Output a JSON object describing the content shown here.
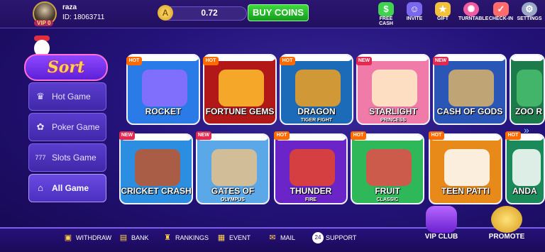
{
  "header": {
    "username": "raza",
    "user_id": "ID: 18063711",
    "vip": "VIP 0",
    "balance": "0.72",
    "buy_coins": "BUY COINS",
    "shortcuts": [
      {
        "label": "FREE CASH",
        "icon": "cash-icon",
        "color": "#3fd34e"
      },
      {
        "label": "INVITE",
        "icon": "invite-icon",
        "color": "#7a67f0"
      },
      {
        "label": "GIFT",
        "icon": "gift-icon",
        "color": "#f2c23a"
      },
      {
        "label": "TURNTABLE",
        "icon": "turntable-icon",
        "color": "#f25aa2"
      },
      {
        "label": "CHECK-IN",
        "icon": "checkin-icon",
        "color": "#ff6a6a"
      },
      {
        "label": "SETTINGS",
        "icon": "gear-icon",
        "color": "#9aa7c7"
      }
    ]
  },
  "sidebar": {
    "logo": "Sort",
    "items": [
      {
        "label": "Hot Game",
        "icon": "crown-icon"
      },
      {
        "label": "Poker Game",
        "icon": "poker-chip-icon"
      },
      {
        "label": "Slots Game",
        "icon": "slots-icon"
      },
      {
        "label": "All Game",
        "icon": "home-icon"
      }
    ]
  },
  "games": {
    "row1": [
      {
        "title": "ROCKET",
        "sub": "",
        "tag": "HOT",
        "color": "#2a7be8",
        "art": "#8f6dff"
      },
      {
        "title": "FORTUNE GEMS",
        "sub": "",
        "tag": "HOT",
        "color": "#b31818",
        "art": "#ffc12b"
      },
      {
        "title": "DRAGON",
        "sub": "TIGER FIGHT",
        "tag": "HOT",
        "color": "#1b6bb8",
        "art": "#f0a020"
      },
      {
        "title": "STARLIGHT",
        "sub": "PRINCESS",
        "tag": "NEW",
        "color": "#f07aa8",
        "art": "#fff0c8"
      },
      {
        "title": "CASH OF GODS",
        "sub": "",
        "tag": "NEW",
        "color": "#2a56b8",
        "art": "#d9b26a"
      },
      {
        "title": "ZOO R",
        "sub": "",
        "tag": "",
        "color": "#1d7a4a",
        "art": "#4ac070"
      }
    ],
    "row2": [
      {
        "title": "CRICKET CRASH",
        "sub": "",
        "tag": "NEW",
        "color": "#2b8ee0",
        "art": "#c0552a"
      },
      {
        "title": "GATES OF",
        "sub": "OLYMPUS",
        "tag": "NEW",
        "color": "#5aa8e8",
        "art": "#e6c28a"
      },
      {
        "title": "THUNDER",
        "sub": "FIRE",
        "tag": "HOT",
        "color": "#6b24c8",
        "art": "#e8442a"
      },
      {
        "title": "FRUIT",
        "sub": "CLASSIC",
        "tag": "HOT",
        "color": "#2fb85a",
        "art": "#e84a4a"
      },
      {
        "title": "TEEN PATTI",
        "sub": "",
        "tag": "HOT",
        "color": "#e88a1a",
        "art": "#ffffff"
      },
      {
        "title": "ANDA",
        "sub": "",
        "tag": "HOT",
        "color": "#1a8a5a",
        "art": "#ffffff"
      }
    ]
  },
  "footer": {
    "items": [
      {
        "label": "WITHDRAW",
        "icon": "withdraw-icon"
      },
      {
        "label": "BANK",
        "icon": "bank-icon"
      },
      {
        "label": "RANKINGS",
        "icon": "trophy-icon"
      },
      {
        "label": "EVENT",
        "icon": "event-icon"
      },
      {
        "label": "MAIL",
        "icon": "mail-icon"
      },
      {
        "label": "SUPPORT",
        "icon": "support-icon",
        "badge": "24"
      }
    ],
    "vip_club": "VIP CLUB",
    "promote": "PROMOTE"
  }
}
